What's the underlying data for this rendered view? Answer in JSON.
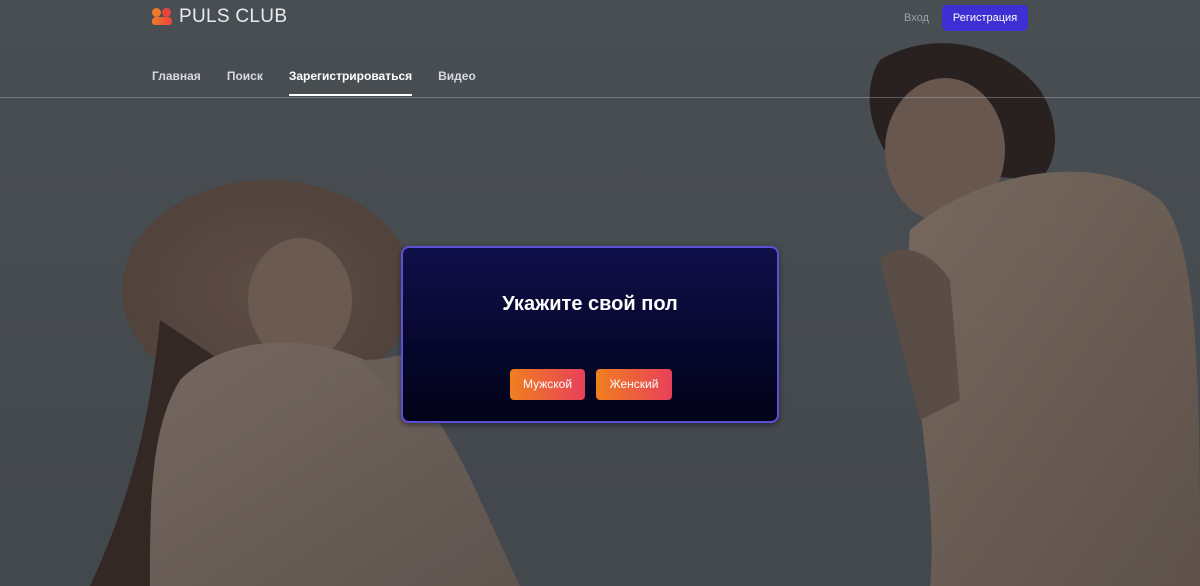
{
  "brand": {
    "name": "PULS CLUB",
    "logo_colors": [
      "#f07a2a",
      "#e8453c"
    ]
  },
  "header": {
    "login_label": "Вход",
    "register_label": "Регистрация",
    "register_color": "#3e2fd4"
  },
  "nav": {
    "items": [
      {
        "label": "Главная",
        "active": false
      },
      {
        "label": "Поиск",
        "active": false
      },
      {
        "label": "Зарегистрироваться",
        "active": true
      },
      {
        "label": "Видео",
        "active": false
      }
    ]
  },
  "modal": {
    "title": "Укажите свой пол",
    "options": [
      "Мужской",
      "Женский"
    ],
    "border_color": "#5c4fd8",
    "button_gradient": [
      "#f07f1f",
      "#e8405a"
    ]
  },
  "background": {
    "description_icon": "couple-photo"
  }
}
